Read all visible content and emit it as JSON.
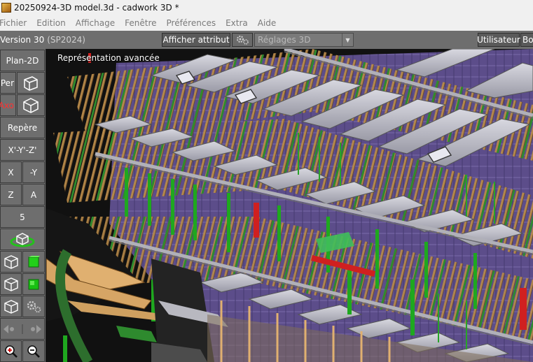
{
  "window": {
    "title": "20250924-3D model.3d - cadwork 3D *"
  },
  "menu": {
    "items": [
      "Fichier",
      "Edition",
      "Affichage",
      "Fenêtre",
      "Préférences",
      "Extra",
      "Aide"
    ]
  },
  "toolbar": {
    "version": "Version 30",
    "sp": "(SP2024)",
    "afficher_attribut": "Afficher attribut",
    "reglages": "Réglages 3D",
    "utilisateur": "Utilisateur",
    "bo": "Bo"
  },
  "sidebar": {
    "plan2d": "Plan-2D",
    "per": "Per",
    "axo": "Axo",
    "repere": "Repère",
    "xyz": "X'-Y'-Z'",
    "x": "X",
    "ny": "-Y",
    "z": "Z",
    "a": "A",
    "five": "5"
  },
  "viewport": {
    "label": "Représentation avancée"
  },
  "colors": {
    "accent_green": "#22c21a",
    "red_axo": "#ff3030",
    "toolbar_bg": "#6e6e6e"
  }
}
